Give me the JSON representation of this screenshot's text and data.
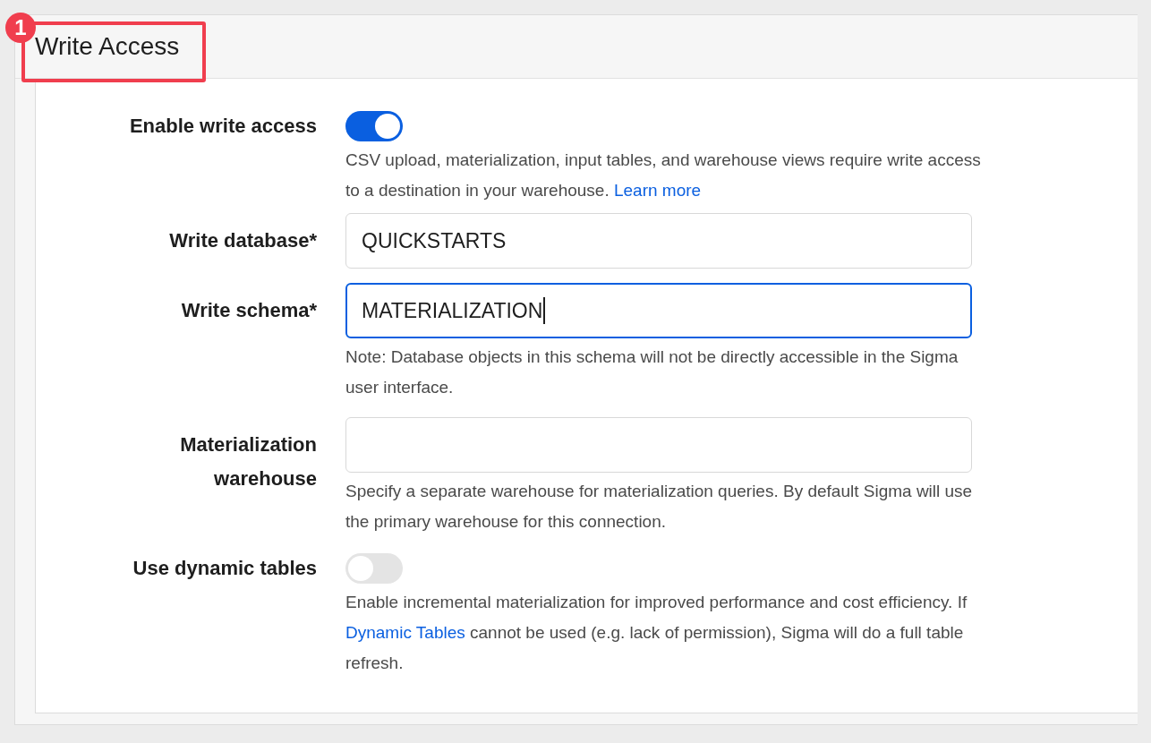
{
  "annotation": {
    "number": "1"
  },
  "section": {
    "title": "Write Access"
  },
  "rows": [
    {
      "kind": "toggle",
      "label": "Enable write access",
      "on": true,
      "help": [
        {
          "kind": "text",
          "text": "CSV upload, materialization, input tables, and warehouse views require write access to a destination in your warehouse. "
        },
        {
          "kind": "link",
          "text": "Learn more"
        }
      ]
    },
    {
      "kind": "input",
      "label": "Write database*",
      "value": "QUICKSTARTS",
      "focused": false
    },
    {
      "kind": "input",
      "label": "Write schema*",
      "value": "MATERIALIZATION",
      "focused": true,
      "help": [
        {
          "kind": "text",
          "text": "Note: Database objects in this schema will not be directly accessible in the Sigma user interface."
        }
      ]
    },
    {
      "kind": "input",
      "label": "Materialization warehouse",
      "focused": false,
      "help": [
        {
          "kind": "text",
          "text": "Specify a separate warehouse for materialization queries. By default Sigma will use the primary warehouse for this connection."
        }
      ]
    },
    {
      "kind": "toggle",
      "label": "Use dynamic tables",
      "on": false,
      "help": [
        {
          "kind": "text",
          "text": "Enable incremental materialization for improved performance and cost efficiency. If "
        },
        {
          "kind": "link",
          "text": "Dynamic Tables"
        },
        {
          "kind": "text",
          "text": " cannot be used (e.g. lack of permission), Sigma will do a full table refresh."
        }
      ]
    }
  ]
}
